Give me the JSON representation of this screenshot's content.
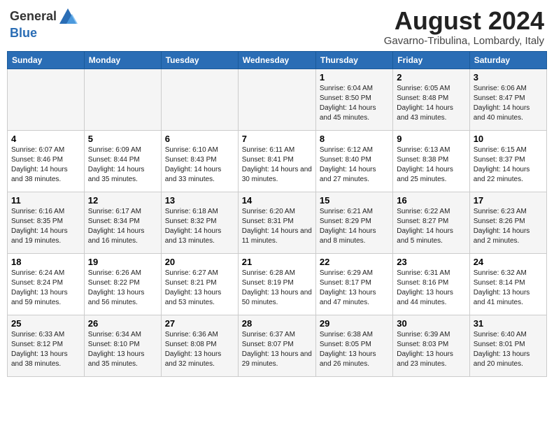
{
  "header": {
    "logo_general": "General",
    "logo_blue": "Blue",
    "month_title": "August 2024",
    "location": "Gavarno-Tribulina, Lombardy, Italy"
  },
  "days_of_week": [
    "Sunday",
    "Monday",
    "Tuesday",
    "Wednesday",
    "Thursday",
    "Friday",
    "Saturday"
  ],
  "weeks": [
    [
      {
        "day": "",
        "info": ""
      },
      {
        "day": "",
        "info": ""
      },
      {
        "day": "",
        "info": ""
      },
      {
        "day": "",
        "info": ""
      },
      {
        "day": "1",
        "info": "Sunrise: 6:04 AM\nSunset: 8:50 PM\nDaylight: 14 hours and 45 minutes."
      },
      {
        "day": "2",
        "info": "Sunrise: 6:05 AM\nSunset: 8:48 PM\nDaylight: 14 hours and 43 minutes."
      },
      {
        "day": "3",
        "info": "Sunrise: 6:06 AM\nSunset: 8:47 PM\nDaylight: 14 hours and 40 minutes."
      }
    ],
    [
      {
        "day": "4",
        "info": "Sunrise: 6:07 AM\nSunset: 8:46 PM\nDaylight: 14 hours and 38 minutes."
      },
      {
        "day": "5",
        "info": "Sunrise: 6:09 AM\nSunset: 8:44 PM\nDaylight: 14 hours and 35 minutes."
      },
      {
        "day": "6",
        "info": "Sunrise: 6:10 AM\nSunset: 8:43 PM\nDaylight: 14 hours and 33 minutes."
      },
      {
        "day": "7",
        "info": "Sunrise: 6:11 AM\nSunset: 8:41 PM\nDaylight: 14 hours and 30 minutes."
      },
      {
        "day": "8",
        "info": "Sunrise: 6:12 AM\nSunset: 8:40 PM\nDaylight: 14 hours and 27 minutes."
      },
      {
        "day": "9",
        "info": "Sunrise: 6:13 AM\nSunset: 8:38 PM\nDaylight: 14 hours and 25 minutes."
      },
      {
        "day": "10",
        "info": "Sunrise: 6:15 AM\nSunset: 8:37 PM\nDaylight: 14 hours and 22 minutes."
      }
    ],
    [
      {
        "day": "11",
        "info": "Sunrise: 6:16 AM\nSunset: 8:35 PM\nDaylight: 14 hours and 19 minutes."
      },
      {
        "day": "12",
        "info": "Sunrise: 6:17 AM\nSunset: 8:34 PM\nDaylight: 14 hours and 16 minutes."
      },
      {
        "day": "13",
        "info": "Sunrise: 6:18 AM\nSunset: 8:32 PM\nDaylight: 14 hours and 13 minutes."
      },
      {
        "day": "14",
        "info": "Sunrise: 6:20 AM\nSunset: 8:31 PM\nDaylight: 14 hours and 11 minutes."
      },
      {
        "day": "15",
        "info": "Sunrise: 6:21 AM\nSunset: 8:29 PM\nDaylight: 14 hours and 8 minutes."
      },
      {
        "day": "16",
        "info": "Sunrise: 6:22 AM\nSunset: 8:27 PM\nDaylight: 14 hours and 5 minutes."
      },
      {
        "day": "17",
        "info": "Sunrise: 6:23 AM\nSunset: 8:26 PM\nDaylight: 14 hours and 2 minutes."
      }
    ],
    [
      {
        "day": "18",
        "info": "Sunrise: 6:24 AM\nSunset: 8:24 PM\nDaylight: 13 hours and 59 minutes."
      },
      {
        "day": "19",
        "info": "Sunrise: 6:26 AM\nSunset: 8:22 PM\nDaylight: 13 hours and 56 minutes."
      },
      {
        "day": "20",
        "info": "Sunrise: 6:27 AM\nSunset: 8:21 PM\nDaylight: 13 hours and 53 minutes."
      },
      {
        "day": "21",
        "info": "Sunrise: 6:28 AM\nSunset: 8:19 PM\nDaylight: 13 hours and 50 minutes."
      },
      {
        "day": "22",
        "info": "Sunrise: 6:29 AM\nSunset: 8:17 PM\nDaylight: 13 hours and 47 minutes."
      },
      {
        "day": "23",
        "info": "Sunrise: 6:31 AM\nSunset: 8:16 PM\nDaylight: 13 hours and 44 minutes."
      },
      {
        "day": "24",
        "info": "Sunrise: 6:32 AM\nSunset: 8:14 PM\nDaylight: 13 hours and 41 minutes."
      }
    ],
    [
      {
        "day": "25",
        "info": "Sunrise: 6:33 AM\nSunset: 8:12 PM\nDaylight: 13 hours and 38 minutes."
      },
      {
        "day": "26",
        "info": "Sunrise: 6:34 AM\nSunset: 8:10 PM\nDaylight: 13 hours and 35 minutes."
      },
      {
        "day": "27",
        "info": "Sunrise: 6:36 AM\nSunset: 8:08 PM\nDaylight: 13 hours and 32 minutes."
      },
      {
        "day": "28",
        "info": "Sunrise: 6:37 AM\nSunset: 8:07 PM\nDaylight: 13 hours and 29 minutes."
      },
      {
        "day": "29",
        "info": "Sunrise: 6:38 AM\nSunset: 8:05 PM\nDaylight: 13 hours and 26 minutes."
      },
      {
        "day": "30",
        "info": "Sunrise: 6:39 AM\nSunset: 8:03 PM\nDaylight: 13 hours and 23 minutes."
      },
      {
        "day": "31",
        "info": "Sunrise: 6:40 AM\nSunset: 8:01 PM\nDaylight: 13 hours and 20 minutes."
      }
    ]
  ]
}
